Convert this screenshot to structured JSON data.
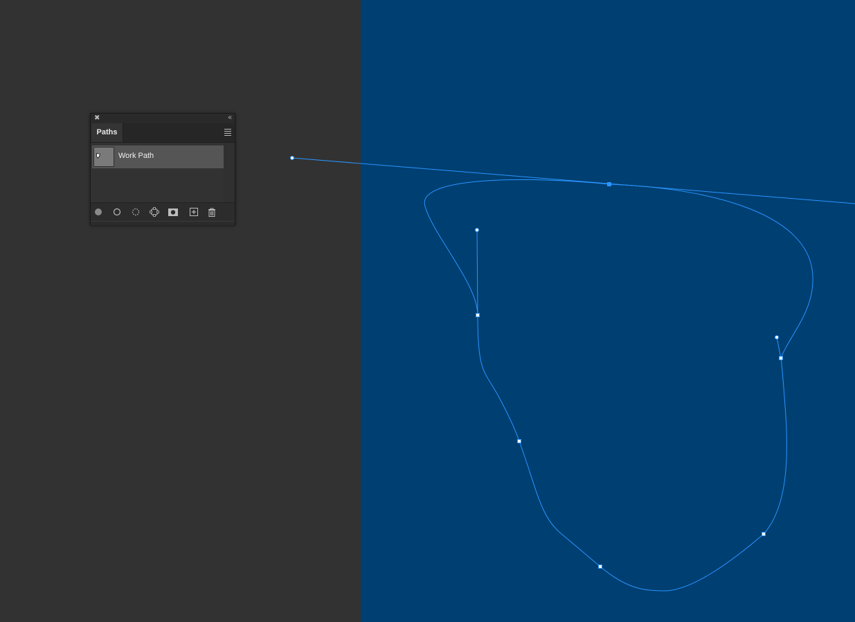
{
  "panel": {
    "close_icon": "close-icon",
    "collapse_glyph": "‹‹",
    "tab_label": "Paths",
    "menu_icon": "panel-menu-icon",
    "paths": [
      {
        "name": "Work Path",
        "selected": true
      }
    ],
    "footer_buttons": [
      {
        "name": "fill-path-button",
        "icon": "filled-circle-icon"
      },
      {
        "name": "stroke-path-button",
        "icon": "hollow-circle-icon"
      },
      {
        "name": "load-as-selection-button",
        "icon": "dotted-circle-icon"
      },
      {
        "name": "make-work-path-button",
        "icon": "path-from-selection-icon"
      },
      {
        "name": "add-mask-button",
        "icon": "mask-icon"
      },
      {
        "name": "new-path-button",
        "icon": "plus-square-icon"
      },
      {
        "name": "delete-path-button",
        "icon": "trash-icon"
      }
    ]
  },
  "canvas": {
    "background_color": "#003f72",
    "pasteboard_color": "#323232",
    "path_color": "#1f8cff"
  }
}
